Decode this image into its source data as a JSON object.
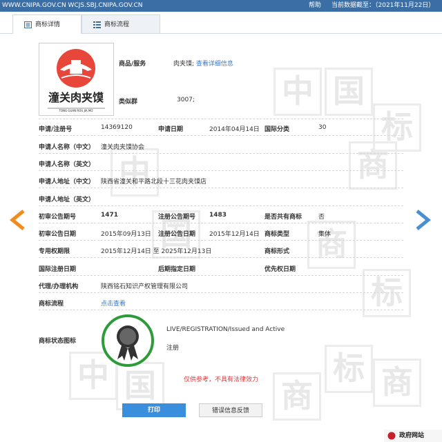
{
  "topbar": {
    "site": "WWW.CNIPA.GOV.CN WCJS.SBJ.CNIPA.GOV.CN",
    "help": "帮助",
    "deadline": "当前数据截至：（2021年11月22日）"
  },
  "tabs": [
    "商标详情",
    "商标流程"
  ],
  "logo": {
    "text": "潼关肉夹馍",
    "subtext": "TONG GUAN ROU JIA MO"
  },
  "fields": {
    "goods_label": "商品/服务",
    "goods_value": "肉夹馍;",
    "goods_link": "查看详细信息",
    "class_label": "类似群",
    "class_value": "3007;",
    "reg_no_label": "申请/注册号",
    "reg_no_value": "14369120",
    "apply_date_label": "申请日期",
    "apply_date_value": "2014年04月14日",
    "intl_class_label": "国际分类",
    "intl_class_value": "30",
    "applicant_cn_label": "申请人名称（中文）",
    "applicant_cn_value": "潼关肉夹馍协会",
    "applicant_en_label": "申请人名称（英文）",
    "address_cn_label": "申请人地址（中文）",
    "address_cn_value": "陕西省潼关和平路北段十三花肉夹馍店",
    "address_en_label": "申请人地址（英文）",
    "prelim_no_label": "初审公告期号",
    "prelim_no_value": "1471",
    "reg_pub_no_label": "注册公告期号",
    "reg_pub_no_value": "1483",
    "shared_label": "是否共有商标",
    "shared_value": "否",
    "prelim_date_label": "初审公告日期",
    "prelim_date_value": "2015年09月13日",
    "reg_pub_date_label": "注册公告日期",
    "reg_pub_date_value": "2015年12月14日",
    "type_label": "商标类型",
    "type_value": "集体",
    "term_label": "专用权期限",
    "term_value": "2015年12月14日 至 2025年12月13日",
    "form_label": "商标形式",
    "intl_reg_date_label": "国际注册日期",
    "later_date_label": "后期指定日期",
    "priority_date_label": "优先权日期",
    "agent_label": "代理/办理机构",
    "agent_value": "陕西铭石知识产权管理有限公司",
    "process_label": "商标流程",
    "process_link": "点击查看",
    "status_icon_label": "商标状态图标",
    "status_en": "LIVE/REGISTRATION/Issued and Active",
    "status_cn": "注册"
  },
  "disclaimer": "仅供参考，不具有法律效力",
  "buttons": {
    "print": "打印",
    "feedback": "错误信息反馈"
  },
  "footer": {
    "gov": "政府网站"
  },
  "watermark_char": [
    "中",
    "国",
    "商",
    "标"
  ],
  "colors": {
    "topbar": "#3a6ea5",
    "arrow_left": "#f08c1e",
    "arrow_right": "#4a90d0",
    "link": "#3a78c9",
    "badge_ring": "#2e9b3a",
    "disclaimer": "#e03a3a"
  }
}
